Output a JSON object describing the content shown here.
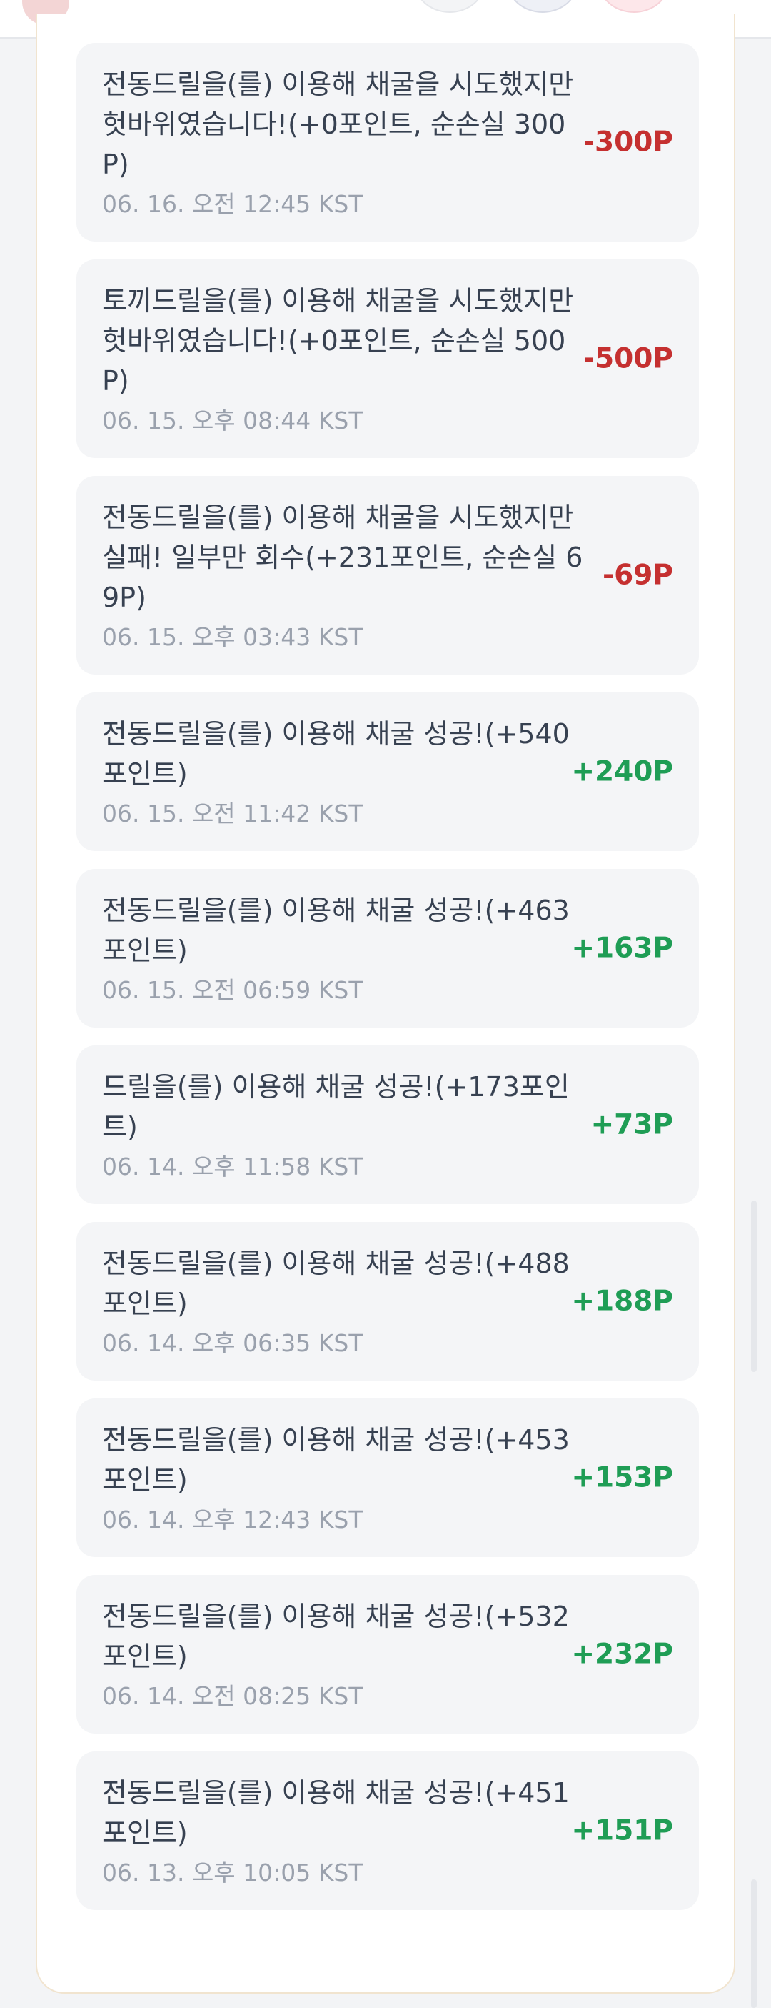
{
  "entries": [
    {
      "message": "전동드릴을(를) 이용해 채굴을 시도했지만 헛바위였습니다!(+0포인트, 순손실 300P)",
      "time": "06. 16. 오전 12:45 KST",
      "amount": "-300P",
      "type": "negative"
    },
    {
      "message": "토끼드릴을(를) 이용해 채굴을 시도했지만 헛바위였습니다!(+0포인트, 순손실 500P)",
      "time": "06. 15. 오후 08:44 KST",
      "amount": "-500P",
      "type": "negative"
    },
    {
      "message": "전동드릴을(를) 이용해 채굴을 시도했지만 실패! 일부만 회수(+231포인트, 순손실 69P)",
      "time": "06. 15. 오후 03:43 KST",
      "amount": "-69P",
      "type": "negative"
    },
    {
      "message": "전동드릴을(를) 이용해 채굴 성공!(+540포인트)",
      "time": "06. 15. 오전 11:42 KST",
      "amount": "+240P",
      "type": "positive"
    },
    {
      "message": "전동드릴을(를) 이용해 채굴 성공!(+463포인트)",
      "time": "06. 15. 오전 06:59 KST",
      "amount": "+163P",
      "type": "positive"
    },
    {
      "message": "드릴을(를) 이용해 채굴 성공!(+173포인트)",
      "time": "06. 14. 오후 11:58 KST",
      "amount": "+73P",
      "type": "positive"
    },
    {
      "message": "전동드릴을(를) 이용해 채굴 성공!(+488포인트)",
      "time": "06. 14. 오후 06:35 KST",
      "amount": "+188P",
      "type": "positive"
    },
    {
      "message": "전동드릴을(를) 이용해 채굴 성공!(+453포인트)",
      "time": "06. 14. 오후 12:43 KST",
      "amount": "+153P",
      "type": "positive"
    },
    {
      "message": "전동드릴을(를) 이용해 채굴 성공!(+532포인트)",
      "time": "06. 14. 오전 08:25 KST",
      "amount": "+232P",
      "type": "positive"
    },
    {
      "message": "전동드릴을(를) 이용해 채굴 성공!(+451포인트)",
      "time": "06. 13. 오후 10:05 KST",
      "amount": "+151P",
      "type": "positive"
    }
  ],
  "colors": {
    "negative": "#c53030",
    "positive": "#1f9d55",
    "card_bg": "#f4f5f7",
    "page_bg": "#f3f4f6"
  }
}
